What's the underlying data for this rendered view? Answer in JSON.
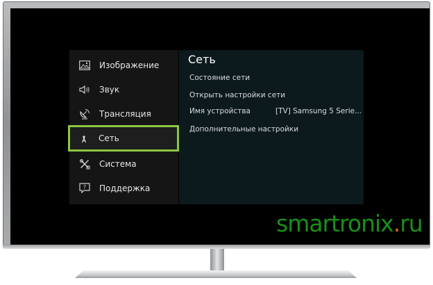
{
  "menu": {
    "items": [
      {
        "label": "Изображение",
        "icon": "picture-icon"
      },
      {
        "label": "Звук",
        "icon": "speaker-icon"
      },
      {
        "label": "Трансляция",
        "icon": "satellite-dish-icon"
      },
      {
        "label": "Сеть",
        "icon": "network-icon",
        "selected": true
      },
      {
        "label": "Система",
        "icon": "tools-icon"
      },
      {
        "label": "Поддержка",
        "icon": "support-icon"
      }
    ]
  },
  "network": {
    "title": "Сеть",
    "items": [
      {
        "label": "Состояние сети"
      },
      {
        "label": "Открыть настройки сети"
      },
      {
        "label": "Имя устройства",
        "value": "[TV] Samsung 5 Serie..."
      },
      {
        "label": "Дополнительные настройки"
      }
    ]
  },
  "watermark": {
    "part1": "smartronix",
    "dot": ".",
    "part2": "ru"
  },
  "colors": {
    "highlight": "#8cc63f",
    "menu_bg": "#151515",
    "submenu_bg": "#0c1a1d",
    "watermark_green": "#1a8f1a",
    "watermark_dot": "#e06020"
  }
}
